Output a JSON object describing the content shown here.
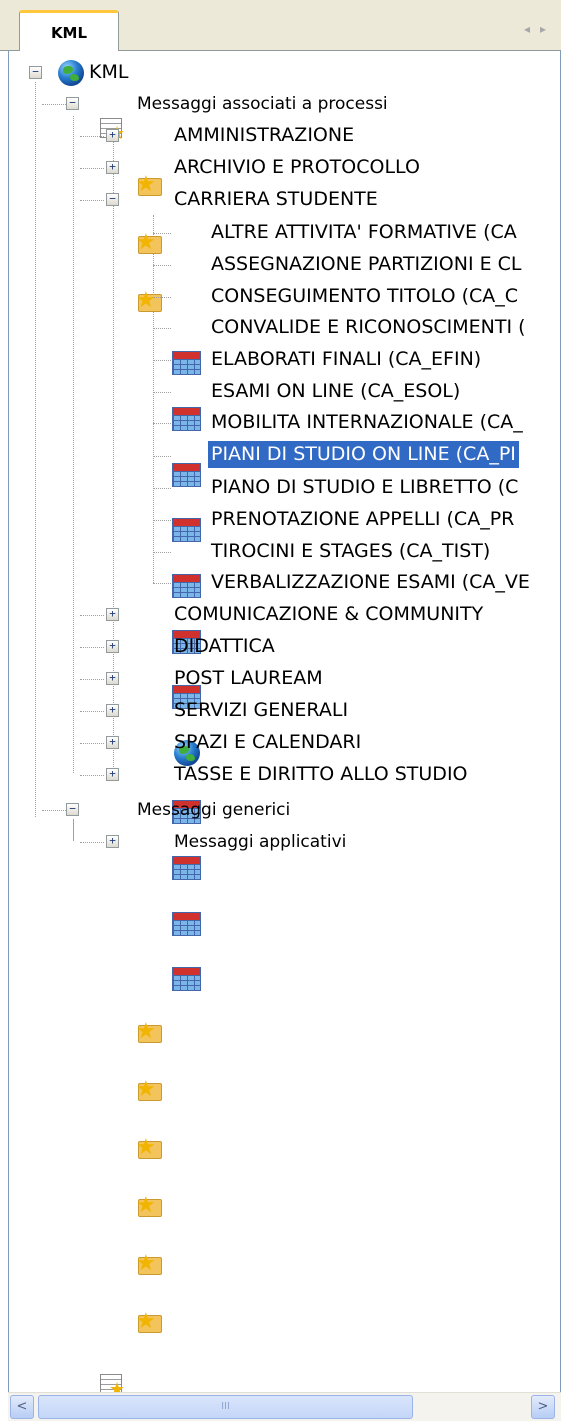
{
  "tabs": {
    "active_label": "KML"
  },
  "tree": {
    "root": "KML",
    "group1": "Messaggi associati a processi",
    "folders1": [
      "AMMINISTRAZIONE",
      "ARCHIVIO E PROTOCOLLO",
      "CARRIERA STUDENTE"
    ],
    "carriera_items": [
      "ALTRE ATTIVITA' FORMATIVE (CA",
      "ASSEGNAZIONE PARTIZIONI E CL",
      "CONSEGUIMENTO TITOLO (CA_C",
      "CONVALIDE E RICONOSCIMENTI (",
      "ELABORATI FINALI (CA_EFIN)",
      "ESAMI ON LINE (CA_ESOL)",
      "MOBILITA INTERNAZIONALE (CA_",
      "PIANI DI STUDIO ON LINE (CA_PI",
      "PIANO DI STUDIO E LIBRETTO (C",
      "PRENOTAZIONE APPELLI (CA_PR",
      "TIROCINI E STAGES (CA_TIST)",
      "VERBALIZZAZIONE ESAMI (CA_VE"
    ],
    "folders2": [
      "COMUNICAZIONE & COMMUNITY",
      "DIDATTICA",
      "POST LAUREAM",
      "SERVIZI GENERALI",
      "SPAZI E CALENDARI",
      "TASSE E DIRITTO ALLO STUDIO"
    ],
    "group2": "Messaggi generici",
    "group2_folder": "Messaggi applicativi"
  },
  "scrollbar": {
    "left_arrow": "<",
    "right_arrow": ">",
    "grip": "III"
  },
  "tab_nav": {
    "left": "◂",
    "right": "▸"
  }
}
